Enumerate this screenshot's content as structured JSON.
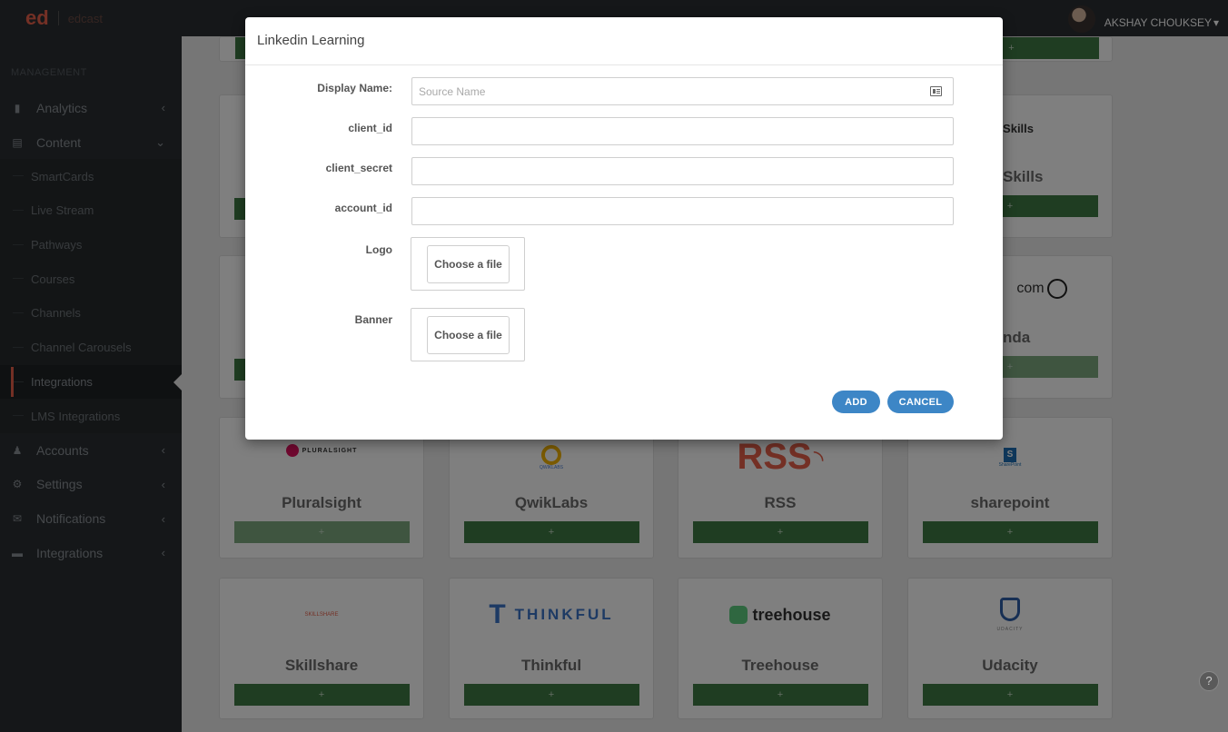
{
  "brand": {
    "logo": "ed",
    "secondary_logo": "edcast"
  },
  "sidebar": {
    "section_label": "MANAGEMENT",
    "items": [
      {
        "label": "Analytics",
        "icon": "bar-chart-icon"
      },
      {
        "label": "Content",
        "icon": "document-icon"
      },
      {
        "label": "SmartCards"
      },
      {
        "label": "Live Stream"
      },
      {
        "label": "Pathways"
      },
      {
        "label": "Courses"
      },
      {
        "label": "Channels"
      },
      {
        "label": "Channel Carousels"
      },
      {
        "label": "Integrations"
      },
      {
        "label": "LMS Integrations"
      },
      {
        "label": "Accounts",
        "icon": "users-icon"
      },
      {
        "label": "Settings",
        "icon": "gears-icon"
      },
      {
        "label": "Notifications",
        "icon": "envelope-icon"
      },
      {
        "label": "Integrations",
        "icon": "briefcase-icon"
      }
    ]
  },
  "user": {
    "name": "AKSHAY CHOUKSEY",
    "caret": "▾"
  },
  "cards": {
    "goskills": {
      "logo": "GoSkills",
      "title": "Skills",
      "button": "+"
    },
    "lynda": {
      "logo": "com",
      "title": "nda",
      "button": "+"
    },
    "pluralsight": {
      "logo": "PLURALSIGHT",
      "title": "Pluralsight",
      "button": "+"
    },
    "qwiklabs": {
      "logo": "QWIKLABS",
      "title": "QwikLabs",
      "button": "+"
    },
    "rss": {
      "logo": "RSS",
      "title": "RSS",
      "button": "+"
    },
    "sharepoint": {
      "logo": "SharePoint",
      "title": "sharepoint",
      "button": "+"
    },
    "skillshare": {
      "logo": "SKILLSHARE",
      "title": "Skillshare",
      "button": "+"
    },
    "thinkful": {
      "logo": "THINKFUL",
      "title": "Thinkful",
      "button": "+"
    },
    "treehouse": {
      "logo": "treehouse",
      "title": "Treehouse",
      "button": "+"
    },
    "udacity": {
      "logo": "UDACITY",
      "title": "Udacity",
      "button": "+"
    },
    "misc_button": "+"
  },
  "modal": {
    "title": "Linkedin Learning",
    "fields": {
      "display_name": {
        "label": "Display Name:",
        "placeholder": "Source Name",
        "value": ""
      },
      "client_id": {
        "label": "client_id",
        "value": ""
      },
      "client_secret": {
        "label": "client_secret",
        "value": ""
      },
      "account_id": {
        "label": "account_id",
        "value": ""
      },
      "logo": {
        "label": "Logo",
        "button": "Choose a file"
      },
      "banner": {
        "label": "Banner",
        "button": "Choose a file"
      }
    },
    "add_label": "ADD",
    "cancel_label": "CANCEL"
  },
  "help": {
    "glyph": "?"
  },
  "colors": {
    "accent": "#e8604a",
    "primary_button": "#3d86c6",
    "add_button": "#3f7b44",
    "sidebar": "#2b2f33"
  }
}
